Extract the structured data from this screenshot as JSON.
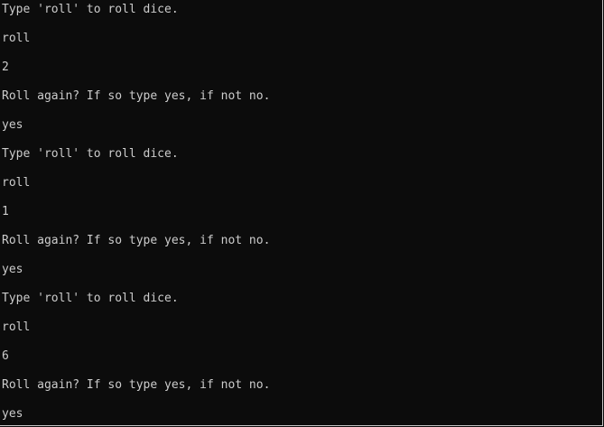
{
  "console": {
    "lines": [
      "Type 'roll' to roll dice.",
      "roll",
      "2",
      "Roll again? If so type yes, if not no.",
      "yes",
      "Type 'roll' to roll dice.",
      "roll",
      "1",
      "Roll again? If so type yes, if not no.",
      "yes",
      "Type 'roll' to roll dice.",
      "roll",
      "6",
      "Roll again? If so type yes, if not no.",
      "yes"
    ]
  },
  "colors": {
    "background": "#0c0c0c",
    "text": "#cccccc"
  }
}
